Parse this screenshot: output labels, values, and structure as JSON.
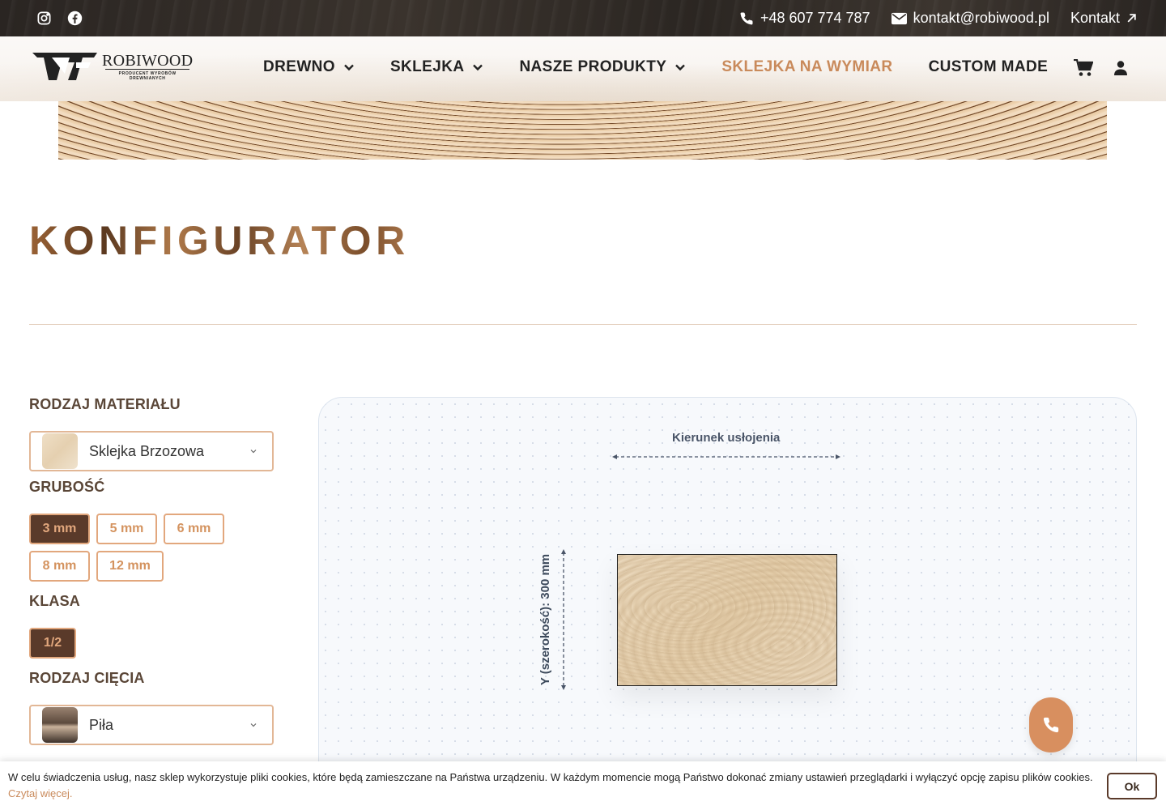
{
  "topbar": {
    "social": [
      "instagram-icon",
      "facebook-icon"
    ],
    "phone": "+48 607 774 787",
    "email": "kontakt@robiwood.pl",
    "contact_link": "Kontakt"
  },
  "logo": {
    "brand": "ROBIWOOD",
    "tagline_1": "PRODUCENT WYROBÓW",
    "tagline_2": "DREWNIANYCH"
  },
  "nav": {
    "items": [
      {
        "label": "DREWNO",
        "has_dropdown": true
      },
      {
        "label": "SKLEJKA",
        "has_dropdown": true
      },
      {
        "label": "NASZE PRODUKTY",
        "has_dropdown": true
      },
      {
        "label": "SKLEJKA NA WYMIAR",
        "active": true
      },
      {
        "label": "CUSTOM MADE"
      }
    ],
    "icons": [
      "cart-icon",
      "user-icon"
    ]
  },
  "page": {
    "title": "KONFIGURATOR"
  },
  "config": {
    "material_label": "RODZAJ MATERIAŁU",
    "material_value": "Sklejka Brzozowa",
    "thickness_label": "GRUBOŚĆ",
    "thickness_options": [
      "3 mm",
      "5 mm",
      "6 mm",
      "8 mm",
      "12 mm"
    ],
    "thickness_selected": "3 mm",
    "class_label": "KLASA",
    "class_options": [
      "1/2"
    ],
    "class_selected": "1/2",
    "cut_label": "RODZAJ CIĘCIA",
    "cut_value": "Piła"
  },
  "preview": {
    "direction_label": "Kierunek usłojenia",
    "y_label": "Y (szerokość): 300 mm"
  },
  "cookie": {
    "text": "W celu świadczenia usług, nasz sklep wykorzystuje pliki cookies, które będą zamieszczane na Państwa urządzeniu. W każdym momencie mogą Państwo dokonać zmiany ustawień przeglądarki i wyłączyć opcję zapisu plików cookies.",
    "more": "Czytaj więcej.",
    "ok": "Ok"
  },
  "colors": {
    "accent": "#c98a5b",
    "selected_chip": "#5a3a2a",
    "call_button": "#d88f5f"
  }
}
